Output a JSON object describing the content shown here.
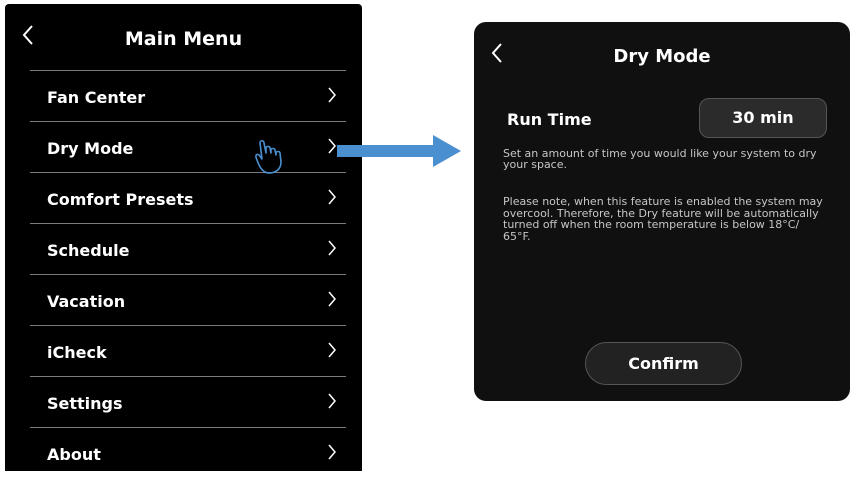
{
  "main_menu": {
    "title": "Main Menu",
    "items": [
      {
        "label": "Fan Center"
      },
      {
        "label": "Dry Mode"
      },
      {
        "label": "Comfort Presets"
      },
      {
        "label": "Schedule"
      },
      {
        "label": "Vacation"
      },
      {
        "label": "iCheck"
      },
      {
        "label": "Settings"
      },
      {
        "label": "About"
      }
    ],
    "pointer_icon": "hand-pointer-icon"
  },
  "transition_arrow": {
    "color": "#4a90d0",
    "icon": "arrow-right-icon"
  },
  "dry_mode": {
    "title": "Dry Mode",
    "run_time_label": "Run Time",
    "run_time_value": "30 min",
    "description": "Set an amount of time you would like your system to dry your space.",
    "note": "Please note, when this feature is enabled the system may overcool. Therefore, the Dry feature will be automatically turned off when the room temperature is below 18°C/ 65°F.",
    "confirm_label": "Confirm"
  },
  "colors": {
    "panel": "#000000",
    "accent": "#4a90d0",
    "text": "#ffffff"
  }
}
